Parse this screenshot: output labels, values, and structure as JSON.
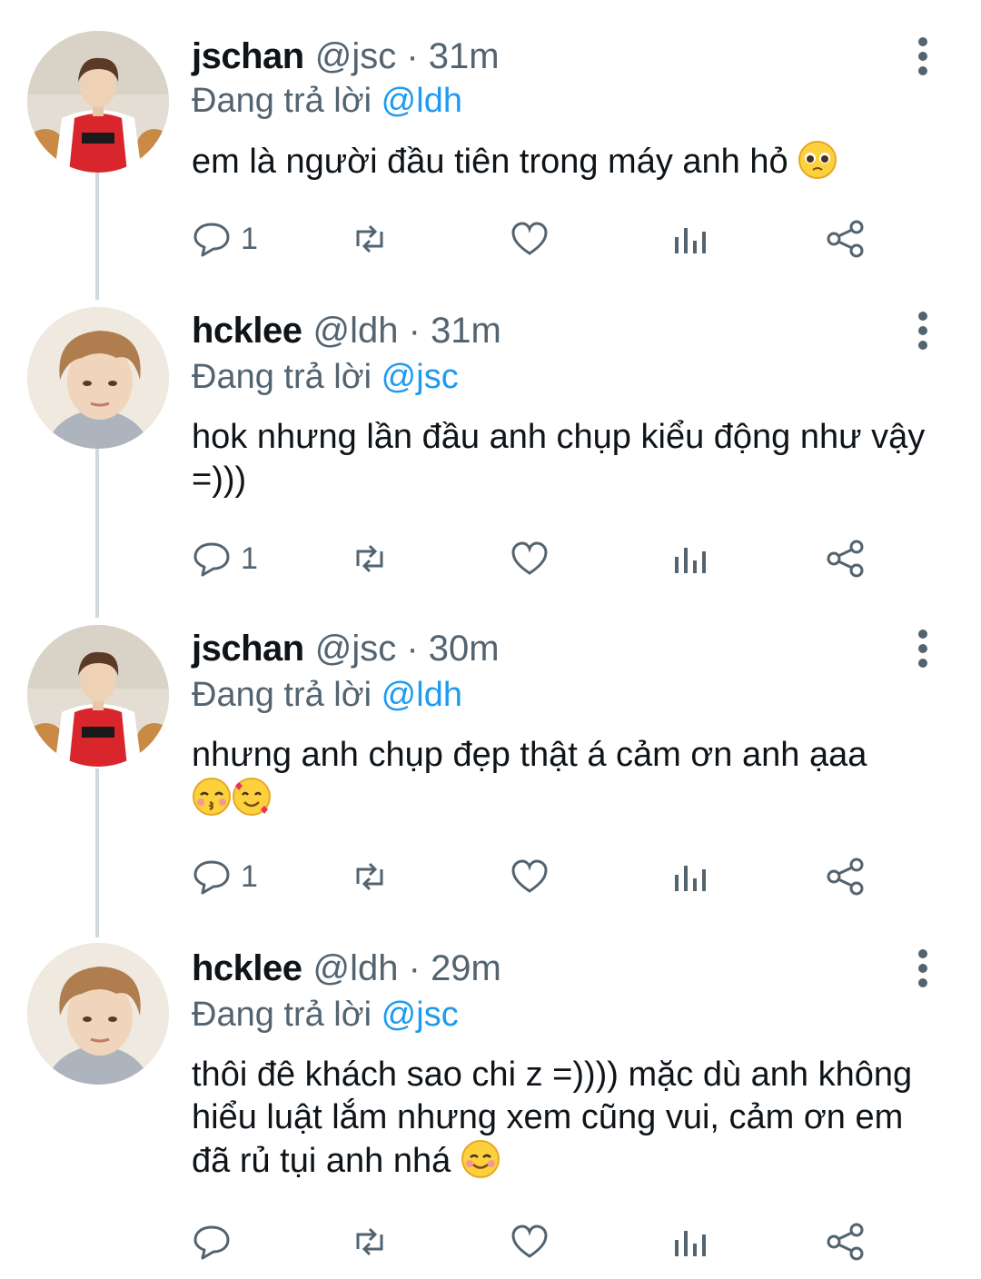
{
  "tweets": [
    {
      "display_name": "jschan",
      "meta": "@jsc · 31m",
      "reply_prefix": "Đang trả lời",
      "reply_to": "@ldh",
      "text": "em là người đầu tiên trong máy anh hỏ",
      "emojis": [
        "pleading-face-emoji"
      ],
      "avatar": "jersey-avatar",
      "reply_count": "1"
    },
    {
      "display_name": "hcklee",
      "meta": "@ldh · 31m",
      "reply_prefix": "Đang trả lời",
      "reply_to": "@jsc",
      "text": "hok nhưng lần đầu anh chụp kiểu động như vậy =)))",
      "emojis": [],
      "avatar": "portrait-avatar",
      "reply_count": "1"
    },
    {
      "display_name": "jschan",
      "meta": "@jsc · 30m",
      "reply_prefix": "Đang trả lời",
      "reply_to": "@ldh",
      "text": "nhưng anh chụp đẹp thật á cảm ơn anh ạaa",
      "emojis": [
        "kissing-face-emoji",
        "smiling-face-with-hearts-emoji"
      ],
      "avatar": "jersey-avatar",
      "reply_count": "1"
    },
    {
      "display_name": "hcklee",
      "meta": "@ldh · 29m",
      "reply_prefix": "Đang trả lời",
      "reply_to": "@jsc",
      "text": "thôi đê khách sao chi z =)))) mặc dù anh không hiểu luật lắm nhưng xem cũng vui, cảm ơn em đã rủ tụi anh nhá",
      "emojis": [
        "smiling-face-emoji"
      ],
      "avatar": "portrait-avatar",
      "reply_count": ""
    }
  ],
  "icons": {
    "reply": "reply-icon",
    "retweet": "retweet-icon",
    "like": "heart-icon",
    "views": "views-icon",
    "share": "share-icon",
    "more": "more-vertical-icon"
  },
  "colors": {
    "text": "#0f1419",
    "muted": "#536471",
    "mention": "#1d9bf0",
    "thread_line": "#cfd9de"
  }
}
